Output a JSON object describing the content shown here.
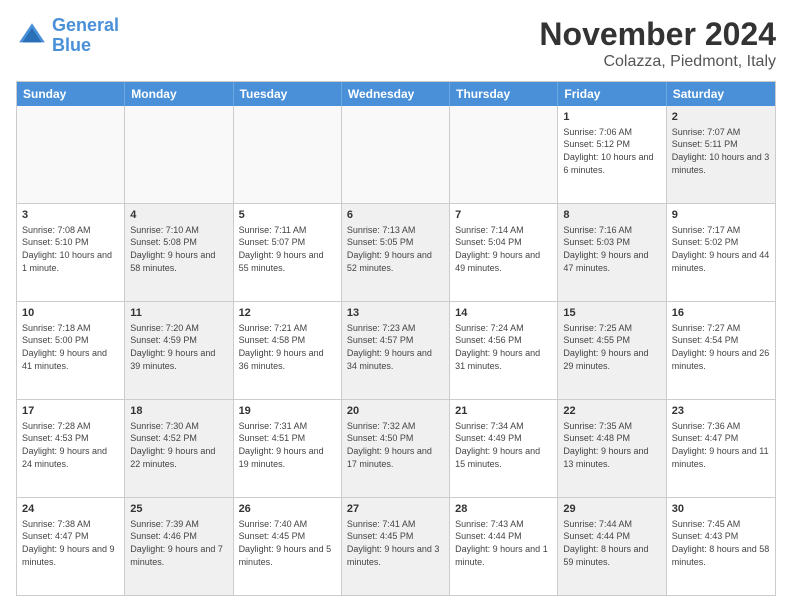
{
  "header": {
    "logo_line1": "General",
    "logo_line2": "Blue",
    "month": "November 2024",
    "location": "Colazza, Piedmont, Italy"
  },
  "weekdays": [
    "Sunday",
    "Monday",
    "Tuesday",
    "Wednesday",
    "Thursday",
    "Friday",
    "Saturday"
  ],
  "rows": [
    [
      {
        "day": "",
        "info": "",
        "shaded": false,
        "empty": true
      },
      {
        "day": "",
        "info": "",
        "shaded": false,
        "empty": true
      },
      {
        "day": "",
        "info": "",
        "shaded": false,
        "empty": true
      },
      {
        "day": "",
        "info": "",
        "shaded": false,
        "empty": true
      },
      {
        "day": "",
        "info": "",
        "shaded": false,
        "empty": true
      },
      {
        "day": "1",
        "info": "Sunrise: 7:06 AM\nSunset: 5:12 PM\nDaylight: 10 hours and 6 minutes.",
        "shaded": false,
        "empty": false
      },
      {
        "day": "2",
        "info": "Sunrise: 7:07 AM\nSunset: 5:11 PM\nDaylight: 10 hours and 3 minutes.",
        "shaded": true,
        "empty": false
      }
    ],
    [
      {
        "day": "3",
        "info": "Sunrise: 7:08 AM\nSunset: 5:10 PM\nDaylight: 10 hours and 1 minute.",
        "shaded": false,
        "empty": false
      },
      {
        "day": "4",
        "info": "Sunrise: 7:10 AM\nSunset: 5:08 PM\nDaylight: 9 hours and 58 minutes.",
        "shaded": true,
        "empty": false
      },
      {
        "day": "5",
        "info": "Sunrise: 7:11 AM\nSunset: 5:07 PM\nDaylight: 9 hours and 55 minutes.",
        "shaded": false,
        "empty": false
      },
      {
        "day": "6",
        "info": "Sunrise: 7:13 AM\nSunset: 5:05 PM\nDaylight: 9 hours and 52 minutes.",
        "shaded": true,
        "empty": false
      },
      {
        "day": "7",
        "info": "Sunrise: 7:14 AM\nSunset: 5:04 PM\nDaylight: 9 hours and 49 minutes.",
        "shaded": false,
        "empty": false
      },
      {
        "day": "8",
        "info": "Sunrise: 7:16 AM\nSunset: 5:03 PM\nDaylight: 9 hours and 47 minutes.",
        "shaded": true,
        "empty": false
      },
      {
        "day": "9",
        "info": "Sunrise: 7:17 AM\nSunset: 5:02 PM\nDaylight: 9 hours and 44 minutes.",
        "shaded": false,
        "empty": false
      }
    ],
    [
      {
        "day": "10",
        "info": "Sunrise: 7:18 AM\nSunset: 5:00 PM\nDaylight: 9 hours and 41 minutes.",
        "shaded": false,
        "empty": false
      },
      {
        "day": "11",
        "info": "Sunrise: 7:20 AM\nSunset: 4:59 PM\nDaylight: 9 hours and 39 minutes.",
        "shaded": true,
        "empty": false
      },
      {
        "day": "12",
        "info": "Sunrise: 7:21 AM\nSunset: 4:58 PM\nDaylight: 9 hours and 36 minutes.",
        "shaded": false,
        "empty": false
      },
      {
        "day": "13",
        "info": "Sunrise: 7:23 AM\nSunset: 4:57 PM\nDaylight: 9 hours and 34 minutes.",
        "shaded": true,
        "empty": false
      },
      {
        "day": "14",
        "info": "Sunrise: 7:24 AM\nSunset: 4:56 PM\nDaylight: 9 hours and 31 minutes.",
        "shaded": false,
        "empty": false
      },
      {
        "day": "15",
        "info": "Sunrise: 7:25 AM\nSunset: 4:55 PM\nDaylight: 9 hours and 29 minutes.",
        "shaded": true,
        "empty": false
      },
      {
        "day": "16",
        "info": "Sunrise: 7:27 AM\nSunset: 4:54 PM\nDaylight: 9 hours and 26 minutes.",
        "shaded": false,
        "empty": false
      }
    ],
    [
      {
        "day": "17",
        "info": "Sunrise: 7:28 AM\nSunset: 4:53 PM\nDaylight: 9 hours and 24 minutes.",
        "shaded": false,
        "empty": false
      },
      {
        "day": "18",
        "info": "Sunrise: 7:30 AM\nSunset: 4:52 PM\nDaylight: 9 hours and 22 minutes.",
        "shaded": true,
        "empty": false
      },
      {
        "day": "19",
        "info": "Sunrise: 7:31 AM\nSunset: 4:51 PM\nDaylight: 9 hours and 19 minutes.",
        "shaded": false,
        "empty": false
      },
      {
        "day": "20",
        "info": "Sunrise: 7:32 AM\nSunset: 4:50 PM\nDaylight: 9 hours and 17 minutes.",
        "shaded": true,
        "empty": false
      },
      {
        "day": "21",
        "info": "Sunrise: 7:34 AM\nSunset: 4:49 PM\nDaylight: 9 hours and 15 minutes.",
        "shaded": false,
        "empty": false
      },
      {
        "day": "22",
        "info": "Sunrise: 7:35 AM\nSunset: 4:48 PM\nDaylight: 9 hours and 13 minutes.",
        "shaded": true,
        "empty": false
      },
      {
        "day": "23",
        "info": "Sunrise: 7:36 AM\nSunset: 4:47 PM\nDaylight: 9 hours and 11 minutes.",
        "shaded": false,
        "empty": false
      }
    ],
    [
      {
        "day": "24",
        "info": "Sunrise: 7:38 AM\nSunset: 4:47 PM\nDaylight: 9 hours and 9 minutes.",
        "shaded": false,
        "empty": false
      },
      {
        "day": "25",
        "info": "Sunrise: 7:39 AM\nSunset: 4:46 PM\nDaylight: 9 hours and 7 minutes.",
        "shaded": true,
        "empty": false
      },
      {
        "day": "26",
        "info": "Sunrise: 7:40 AM\nSunset: 4:45 PM\nDaylight: 9 hours and 5 minutes.",
        "shaded": false,
        "empty": false
      },
      {
        "day": "27",
        "info": "Sunrise: 7:41 AM\nSunset: 4:45 PM\nDaylight: 9 hours and 3 minutes.",
        "shaded": true,
        "empty": false
      },
      {
        "day": "28",
        "info": "Sunrise: 7:43 AM\nSunset: 4:44 PM\nDaylight: 9 hours and 1 minute.",
        "shaded": false,
        "empty": false
      },
      {
        "day": "29",
        "info": "Sunrise: 7:44 AM\nSunset: 4:44 PM\nDaylight: 8 hours and 59 minutes.",
        "shaded": true,
        "empty": false
      },
      {
        "day": "30",
        "info": "Sunrise: 7:45 AM\nSunset: 4:43 PM\nDaylight: 8 hours and 58 minutes.",
        "shaded": false,
        "empty": false
      }
    ]
  ]
}
